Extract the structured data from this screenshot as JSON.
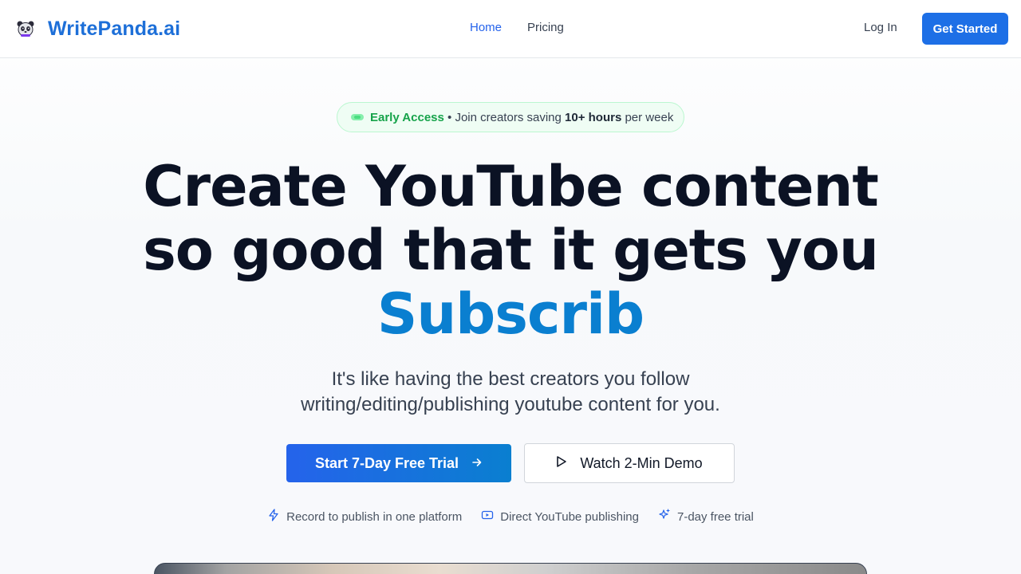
{
  "header": {
    "brand": "WritePanda.ai",
    "nav": [
      "Home",
      "Pricing"
    ],
    "login": "Log In",
    "cta": "Get Started"
  },
  "badge": {
    "label": "Early Access",
    "text_before": " • Join creators saving ",
    "highlight": "10+ hours",
    "text_after": " per week"
  },
  "hero": {
    "line1": "Create YouTube content",
    "line2": "so good that it gets you",
    "line3": "Subscrib",
    "subtitle_line1": "It's like having the best creators you follow",
    "subtitle_line2": "writing/editing/publishing youtube content for you."
  },
  "buttons": {
    "primary": "Start 7-Day Free Trial",
    "secondary": "Watch 2-Min Demo"
  },
  "features": [
    "Record to publish in one platform",
    "Direct YouTube publishing",
    "7-day free trial"
  ],
  "colors": {
    "brand": "#1d6fd8",
    "accent": "#0a7fd0",
    "primary_button": "#2563eb",
    "badge_green": "#16a34a"
  },
  "icons": {
    "logo": "panda-icon",
    "arrow": "arrow-right-icon",
    "play": "play-icon",
    "feature_icons": [
      "lightning-icon",
      "youtube-icon",
      "sparkles-icon"
    ]
  }
}
